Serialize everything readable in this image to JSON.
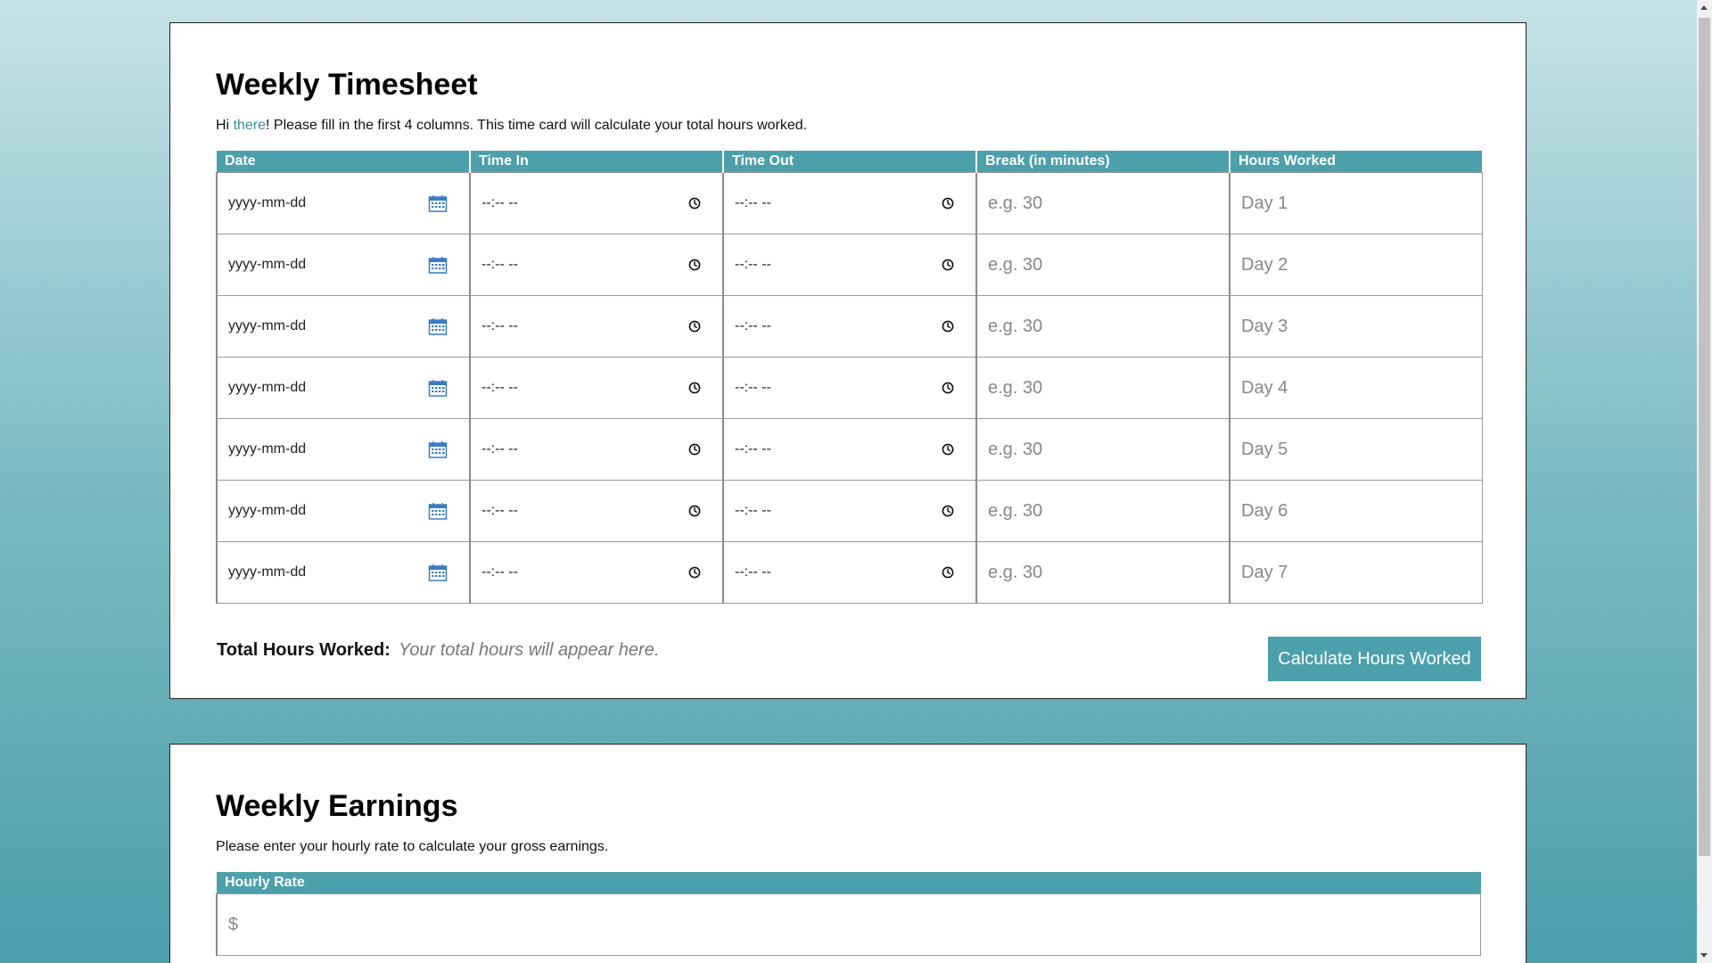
{
  "timesheet": {
    "title": "Weekly Timesheet",
    "intro_prefix": "Hi ",
    "intro_link": "there",
    "intro_suffix": "! Please fill in the first 4 columns. This time card will calculate your total hours worked.",
    "columns": [
      "Date",
      "Time In",
      "Time Out",
      "Break (in minutes)",
      "Hours Worked"
    ],
    "rows": [
      {
        "date": "yyyy-mm-dd",
        "time_in": "--:-- --",
        "time_out": "--:-- --",
        "break": "e.g. 30",
        "hours": "Day 1"
      },
      {
        "date": "yyyy-mm-dd",
        "time_in": "--:-- --",
        "time_out": "--:-- --",
        "break": "e.g. 30",
        "hours": "Day 2"
      },
      {
        "date": "yyyy-mm-dd",
        "time_in": "--:-- --",
        "time_out": "--:-- --",
        "break": "e.g. 30",
        "hours": "Day 3"
      },
      {
        "date": "yyyy-mm-dd",
        "time_in": "--:-- --",
        "time_out": "--:-- --",
        "break": "e.g. 30",
        "hours": "Day 4"
      },
      {
        "date": "yyyy-mm-dd",
        "time_in": "--:-- --",
        "time_out": "--:-- --",
        "break": "e.g. 30",
        "hours": "Day 5"
      },
      {
        "date": "yyyy-mm-dd",
        "time_in": "--:-- --",
        "time_out": "--:-- --",
        "break": "e.g. 30",
        "hours": "Day 6"
      },
      {
        "date": "yyyy-mm-dd",
        "time_in": "--:-- --",
        "time_out": "--:-- --",
        "break": "e.g. 30",
        "hours": "Day 7"
      }
    ],
    "total_label": "Total Hours Worked:",
    "total_placeholder": "Your total hours will appear here.",
    "calculate_button": "Calculate Hours Worked"
  },
  "earnings": {
    "title": "Weekly Earnings",
    "intro": "Please enter your hourly rate to calculate your gross earnings.",
    "column": "Hourly Rate",
    "rate_placeholder": "$"
  },
  "icons": {
    "date": "calendar-icon",
    "time": "clock-icon"
  },
  "colors": {
    "accent": "#4ca0ab",
    "link": "#3b8f9b",
    "background_top": "#c6e3e6",
    "background_bottom": "#4c9fac"
  }
}
